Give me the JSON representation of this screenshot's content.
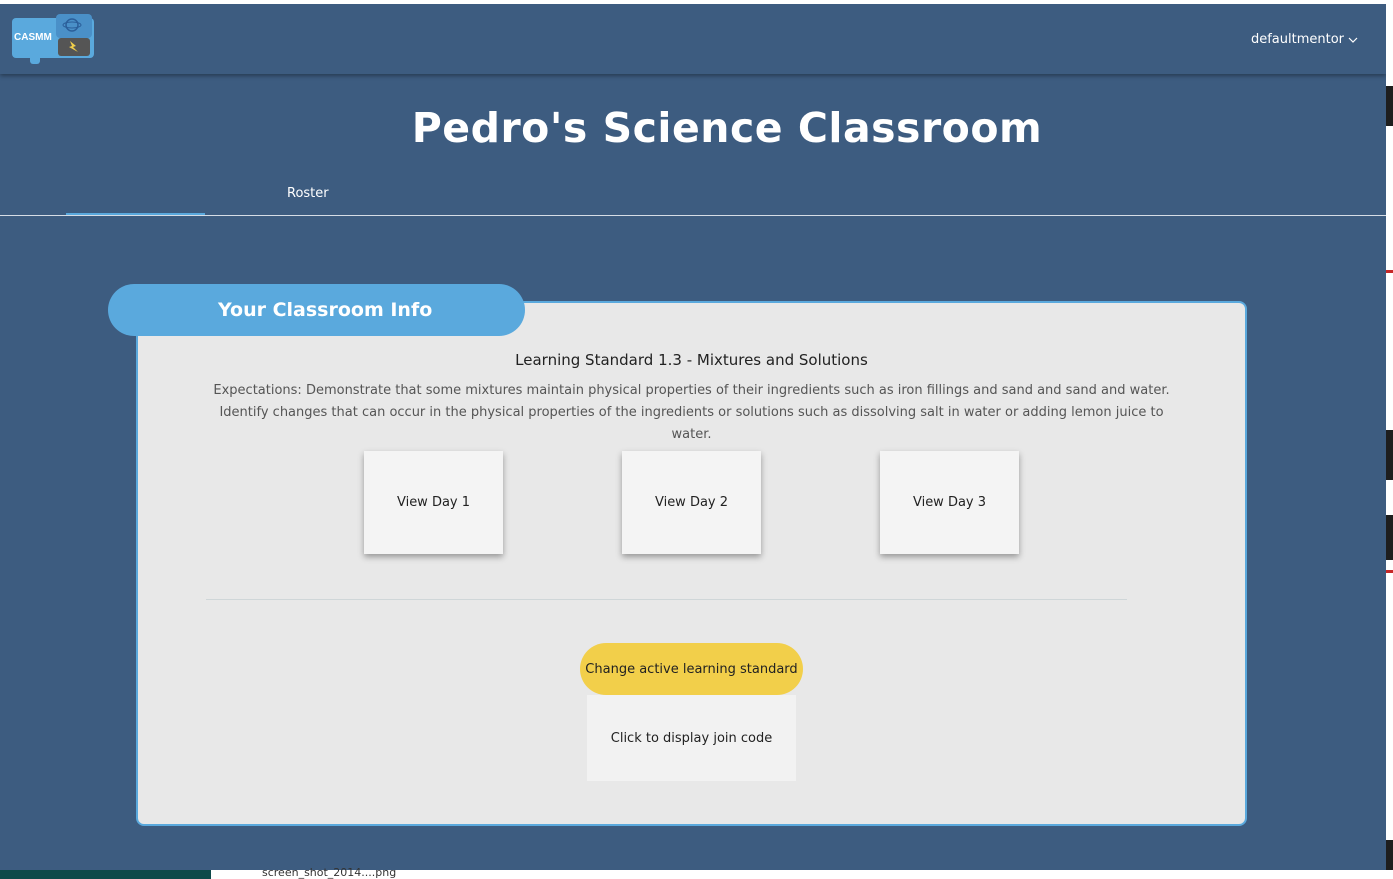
{
  "app": {
    "logo_text": "CASMM",
    "user": "defaultmentor"
  },
  "page": {
    "title": "Pedro's Science Classroom",
    "tabs": [
      {
        "label": "Roster"
      }
    ]
  },
  "classroom_info": {
    "heading": "Your Classroom Info",
    "standard_title": "Learning Standard 1.3 - Mixtures and Solutions",
    "expectations": "Expectations: Demonstrate that some mixtures maintain physical properties of their ingredients such as iron fillings and sand and sand and water. Identify changes that can occur in the physical properties of the ingredients or solutions such as dissolving salt in water or adding lemon juice to water.",
    "days": [
      {
        "label": "View Day 1"
      },
      {
        "label": "View Day 2"
      },
      {
        "label": "View Day 3"
      }
    ],
    "change_standard_label": "Change active learning standard",
    "join_code_label": "Click to display join code"
  },
  "taskbar": {
    "file_label": "screen_shot_2014....png"
  },
  "colors": {
    "background": "#3d5c80",
    "accent": "#5aa9dd",
    "card": "#e8e8e8",
    "yellow_button": "#f2cf4a"
  }
}
